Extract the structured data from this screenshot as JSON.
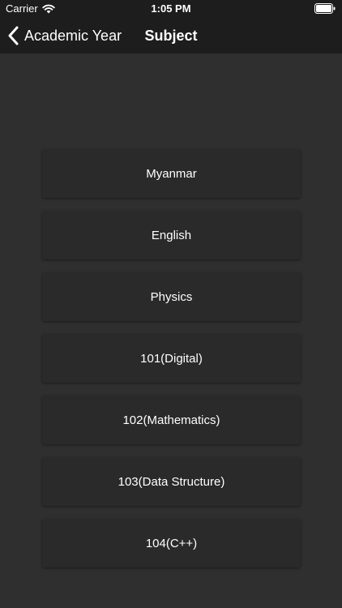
{
  "status_bar": {
    "carrier": "Carrier",
    "time": "1:05 PM"
  },
  "nav": {
    "back_label": "Academic Year",
    "title": "Subject"
  },
  "subjects": [
    {
      "label": "Myanmar"
    },
    {
      "label": "English"
    },
    {
      "label": "Physics"
    },
    {
      "label": "101(Digital)"
    },
    {
      "label": "102(Mathematics)"
    },
    {
      "label": "103(Data Structure)"
    },
    {
      "label": "104(C++)"
    }
  ],
  "colors": {
    "background": "#2f2f2f",
    "bar": "#1d1d1d",
    "button": "#2a2a2a",
    "text": "#ffffff"
  },
  "icons": [
    "wifi-icon",
    "battery-icon",
    "back-chevron-icon"
  ]
}
